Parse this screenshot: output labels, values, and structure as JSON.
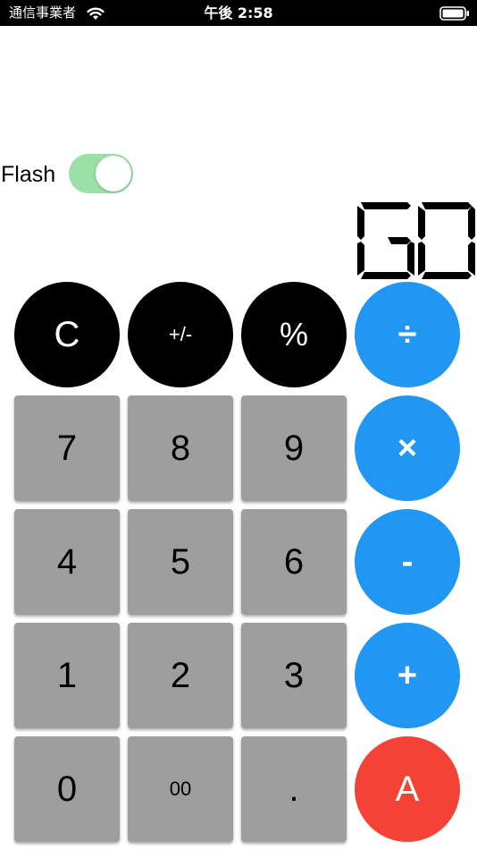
{
  "status_bar": {
    "carrier": "通信事業者",
    "time": "午後 2:58"
  },
  "flash": {
    "label": "Flash",
    "enabled": true,
    "toggle_color": "#9be0a6"
  },
  "display": {
    "value": "GO",
    "style": "seven-segment"
  },
  "keys": {
    "clear": "C",
    "sign": "+/-",
    "percent": "%",
    "divide": "÷",
    "seven": "7",
    "eight": "8",
    "nine": "9",
    "multiply": "×",
    "four": "4",
    "five": "5",
    "six": "6",
    "minus": "-",
    "one": "1",
    "two": "2",
    "three": "3",
    "plus": "+",
    "zero": "0",
    "double_zero": "00",
    "decimal": ".",
    "action": "A"
  },
  "colors": {
    "function_keys": "#000000",
    "operator_keys": "#2196f3",
    "digit_keys": "#9e9e9e",
    "action_key": "#f44336"
  }
}
